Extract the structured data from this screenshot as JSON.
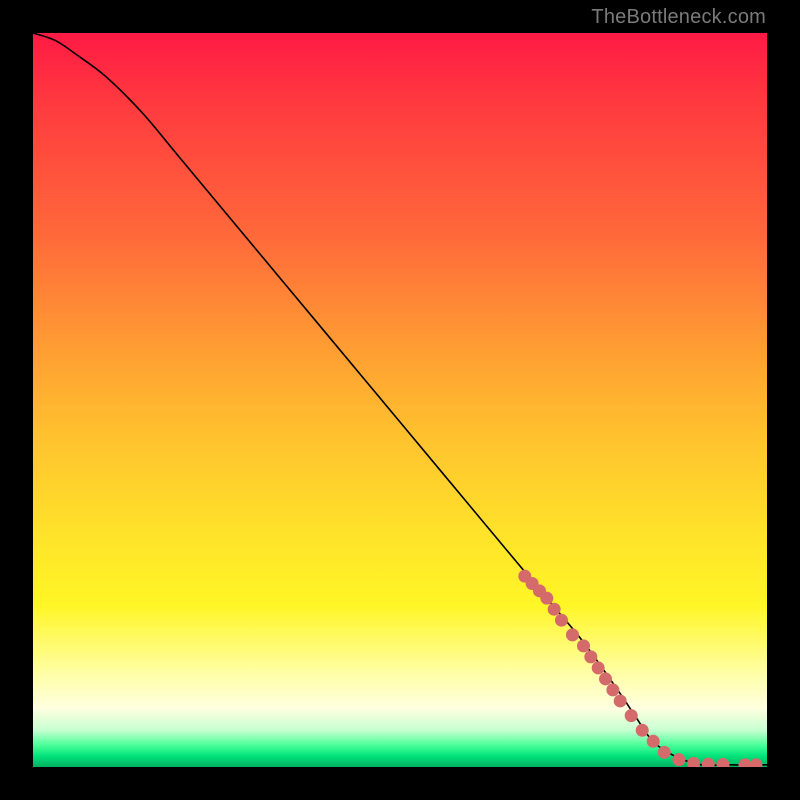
{
  "watermark": "TheBottleneck.com",
  "chart_data": {
    "type": "line",
    "title": "",
    "xlabel": "",
    "ylabel": "",
    "xlim": [
      0,
      100
    ],
    "ylim": [
      0,
      100
    ],
    "grid": false,
    "curve": {
      "name": "curve",
      "x": [
        0,
        3,
        6,
        10,
        15,
        20,
        30,
        40,
        50,
        60,
        70,
        75,
        80,
        82,
        85,
        90,
        95,
        100
      ],
      "y": [
        100,
        99,
        97,
        94,
        89,
        83,
        71,
        59,
        47,
        35,
        23,
        17,
        10,
        7,
        3,
        0.5,
        0.3,
        0.3
      ]
    },
    "dots": {
      "name": "points",
      "x": [
        67,
        68,
        69,
        70,
        71,
        72,
        73.5,
        75,
        76,
        77,
        78,
        79,
        80,
        81.5,
        83,
        84.5,
        86,
        88,
        90,
        92,
        94,
        97,
        98.5
      ],
      "y": [
        26,
        25,
        24,
        23,
        21.5,
        20,
        18,
        16.5,
        15,
        13.5,
        12,
        10.5,
        9,
        7,
        5,
        3.5,
        2,
        1,
        0.5,
        0.4,
        0.35,
        0.3,
        0.3
      ]
    }
  }
}
